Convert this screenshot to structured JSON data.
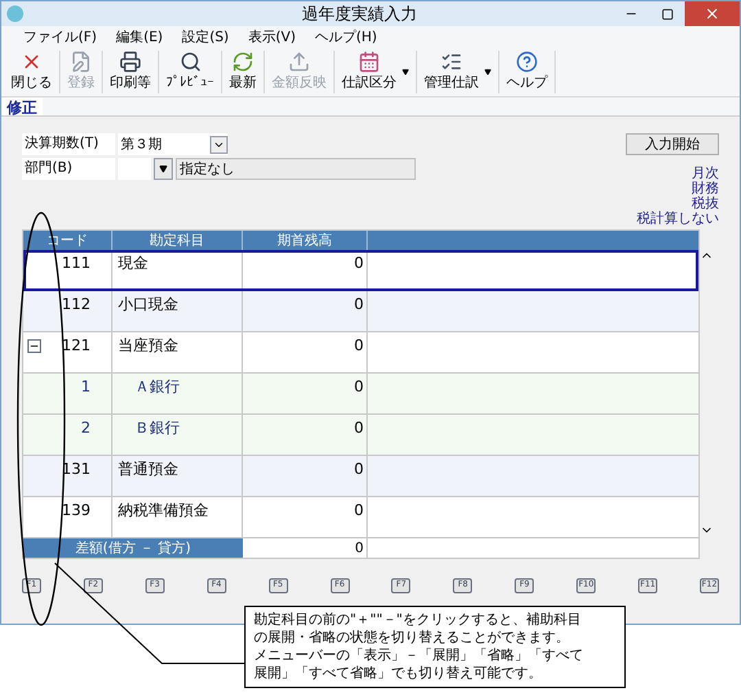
{
  "window": {
    "title": "過年度実績入力"
  },
  "menu": [
    "ファイル(F)",
    "編集(E)",
    "設定(S)",
    "表示(V)",
    "ヘルプ(H)"
  ],
  "toolbar": [
    {
      "label": "閉じる",
      "disabled": false,
      "has_menu": false
    },
    {
      "label": "登録",
      "disabled": true,
      "has_menu": false
    },
    {
      "label": "印刷等",
      "disabled": false,
      "has_menu": false
    },
    {
      "label": "ﾌﾟﾚﾋﾞｭｰ",
      "disabled": false,
      "has_menu": false
    },
    {
      "label": "最新",
      "disabled": false,
      "has_menu": false
    },
    {
      "label": "金額反映",
      "disabled": true,
      "has_menu": false
    },
    {
      "label": "仕訳区分",
      "disabled": false,
      "has_menu": true
    },
    {
      "label": "管理仕訳",
      "disabled": false,
      "has_menu": true
    },
    {
      "label": "ヘルプ",
      "disabled": false,
      "has_menu": false
    }
  ],
  "tabs": [
    {
      "label": "修正",
      "selected": true
    }
  ],
  "form": {
    "period": {
      "label": "決算期数(T)",
      "value": "第３期"
    },
    "department": {
      "label": "部門(B)",
      "value": "指定なし"
    },
    "start_button": "入力開始"
  },
  "modes": [
    "月次",
    "財務",
    "税抜",
    "税計算しない"
  ],
  "table": {
    "columns": [
      "コード",
      "勘定科目",
      "期首残高"
    ],
    "rows": [
      {
        "code": "111",
        "name": "現金",
        "balance": "0",
        "selected": true
      },
      {
        "code": "112",
        "name": "小口現金",
        "balance": "0",
        "selected": false
      },
      {
        "code": "121",
        "name": "当座預金",
        "balance": "0",
        "selected": false,
        "expanded": true,
        "children": [
          {
            "code": "1",
            "name": "Ａ銀行",
            "balance": "0",
            "selected": false
          },
          {
            "code": "2",
            "name": "Ｂ銀行",
            "balance": "0",
            "selected": false
          }
        ]
      },
      {
        "code": "131",
        "name": "普通預金",
        "balance": "0",
        "selected": false
      },
      {
        "code": "139",
        "name": "納税準備預金",
        "balance": "0",
        "selected": false
      }
    ],
    "total": {
      "label": "差額(借方 － 貸方)",
      "balance": "0"
    }
  },
  "function_keys": [
    "F1",
    "F2",
    "F3",
    "F4",
    "F5",
    "F6",
    "F7",
    "F8",
    "F9",
    "F10",
    "F11",
    "F12"
  ],
  "callout": {
    "lines": [
      "勘定科目の前の\"＋\"\"－\"をクリックすると、補助科目",
      "の展開・省略の状態を切り替えることができます。",
      "メニューバーの「表示」－「展開」「省略」「すべて",
      "展開」「すべて省略」でも切り替え可能です。"
    ]
  }
}
